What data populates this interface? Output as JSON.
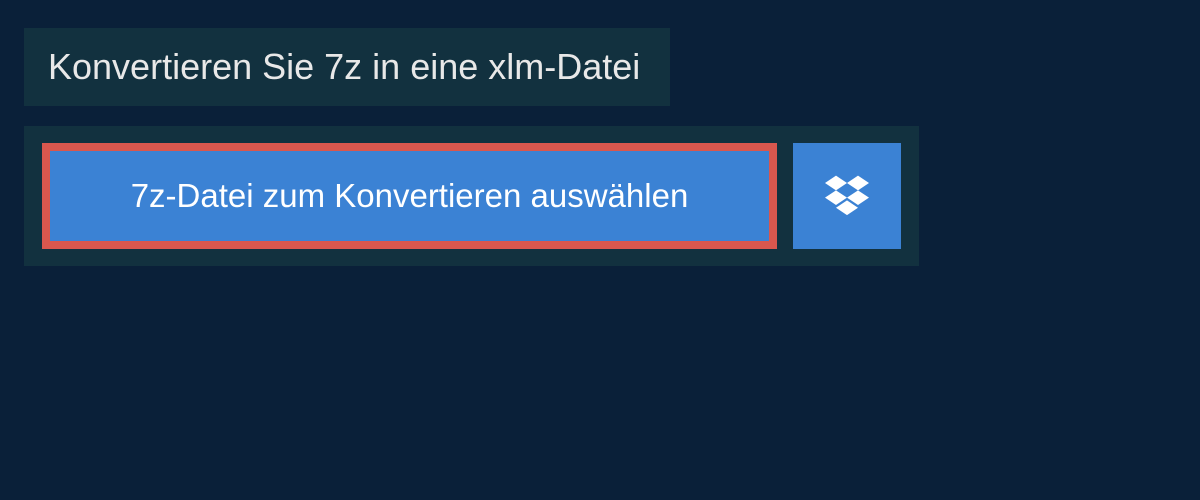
{
  "header": {
    "title": "Konvertieren Sie 7z in eine xlm-Datei"
  },
  "actions": {
    "select_file_label": "7z-Datei zum Konvertieren auswählen"
  },
  "colors": {
    "background": "#0a2039",
    "panel": "#12313f",
    "button": "#3b82d4",
    "highlight_border": "#d9574e"
  }
}
